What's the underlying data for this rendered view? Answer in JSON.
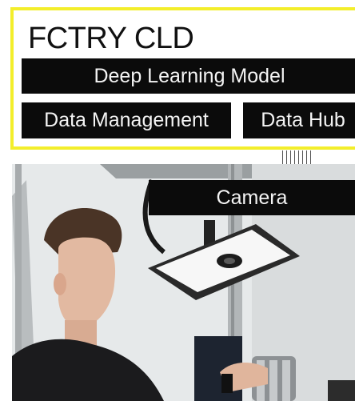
{
  "brand": {
    "title": "FCTRY CLD"
  },
  "blocks": {
    "deep_learning": "Deep Learning Model",
    "data_management": "Data Management",
    "data_hub": "Data Hub"
  },
  "photo": {
    "label": "Camera"
  },
  "colors": {
    "frame": "#f3ee2b",
    "bar": "#0b0b0b",
    "text": "#f4f4f4"
  }
}
